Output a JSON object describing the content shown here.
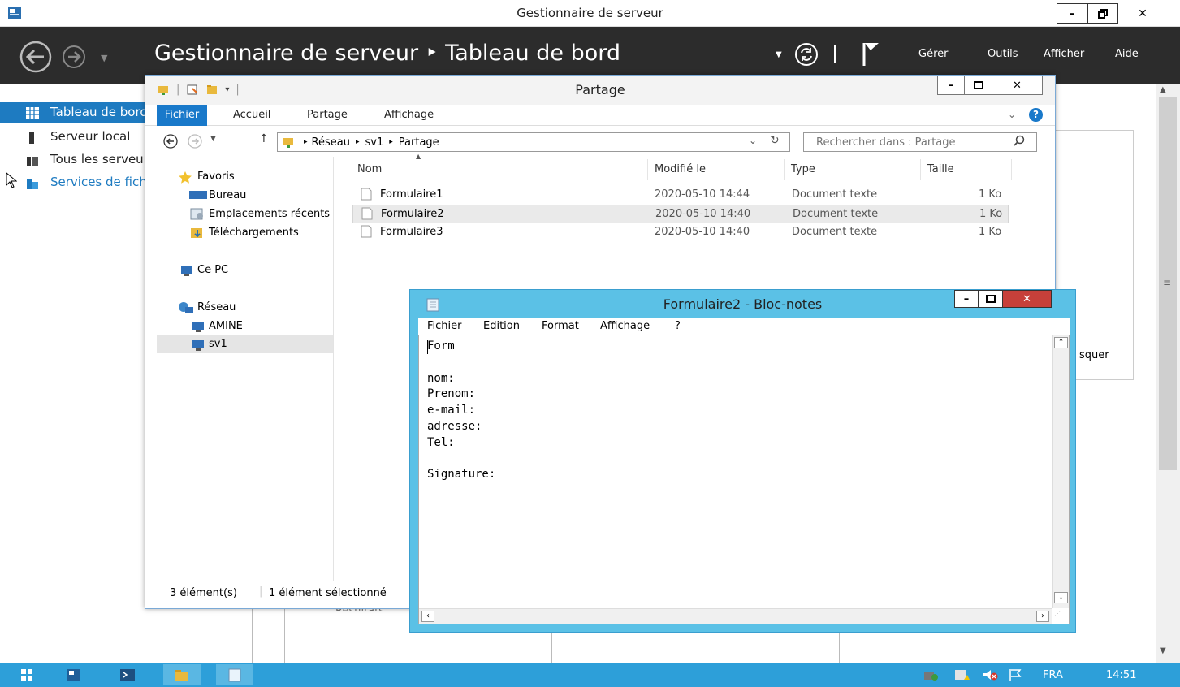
{
  "server_manager": {
    "window_title": "Gestionnaire de serveur",
    "breadcrumb": "Gestionnaire de serveur ‣ Tableau de bord",
    "menu": [
      "Gérer",
      "Outils",
      "Afficher",
      "Aide"
    ],
    "sidebar": [
      {
        "label": "Tableau de bord",
        "icon": "dashboard-icon",
        "selected": true
      },
      {
        "label": "Serveur local",
        "icon": "local-server-icon"
      },
      {
        "label": "Tous les serveurs",
        "icon": "all-servers-icon"
      },
      {
        "label": "Services de fichiers et de stockage",
        "icon": "file-services-icon"
      }
    ],
    "background_text": {
      "hide": "squer",
      "results": "Résultats"
    }
  },
  "explorer": {
    "title": "Partage",
    "ribbon_tabs": [
      "Fichier",
      "Accueil",
      "Partage",
      "Affichage"
    ],
    "address_path": [
      "Réseau",
      "sv1",
      "Partage"
    ],
    "search_placeholder": "Rechercher dans : Partage",
    "nav": {
      "favorites": "Favoris",
      "favorite_items": [
        "Bureau",
        "Emplacements récents",
        "Téléchargements"
      ],
      "this_pc": "Ce PC",
      "network": "Réseau",
      "network_items": [
        "AMINE",
        "sv1"
      ]
    },
    "columns": [
      "Nom",
      "Modifié le",
      "Type",
      "Taille"
    ],
    "files": [
      {
        "name": "Formulaire1",
        "modified": "2020-05-10 14:44",
        "type": "Document texte",
        "size": "1 Ko"
      },
      {
        "name": "Formulaire2",
        "modified": "2020-05-10 14:40",
        "type": "Document texte",
        "size": "1 Ko",
        "selected": true
      },
      {
        "name": "Formulaire3",
        "modified": "2020-05-10 14:40",
        "type": "Document texte",
        "size": "1 Ko"
      }
    ],
    "status_count": "3 élément(s)",
    "status_selected": "1 élément sélectionné"
  },
  "notepad": {
    "title": "Formulaire2 - Bloc-notes",
    "menu": [
      "Fichier",
      "Edition",
      "Format",
      "Affichage",
      "?"
    ],
    "content": "Form\n\nnom:\nPrenom:\ne-mail:\nadresse:\nTel:\n\nSignature:"
  },
  "taskbar": {
    "language": "FRA",
    "time": "14:51",
    "colors": {
      "taskbar": "#2d9fd9",
      "accent": "#1e7bc1",
      "notepad_frame": "#5bc1e6"
    }
  }
}
